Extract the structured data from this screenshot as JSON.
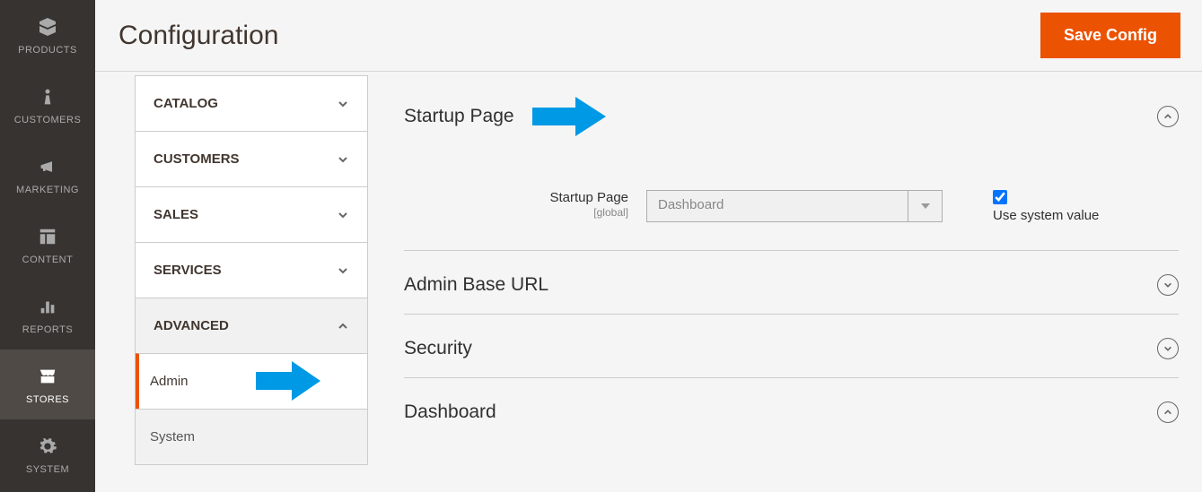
{
  "rail": {
    "items": [
      {
        "label": "PRODUCTS",
        "icon": "box"
      },
      {
        "label": "CUSTOMERS",
        "icon": "person"
      },
      {
        "label": "MARKETING",
        "icon": "megaphone"
      },
      {
        "label": "CONTENT",
        "icon": "layout"
      },
      {
        "label": "REPORTS",
        "icon": "bars"
      },
      {
        "label": "STORES",
        "icon": "store",
        "active": true
      },
      {
        "label": "SYSTEM",
        "icon": "gear"
      }
    ]
  },
  "header": {
    "title": "Configuration",
    "save_label": "Save Config"
  },
  "config_nav": {
    "groups": [
      {
        "label": "CATALOG",
        "expanded": false
      },
      {
        "label": "CUSTOMERS",
        "expanded": false
      },
      {
        "label": "SALES",
        "expanded": false
      },
      {
        "label": "SERVICES",
        "expanded": false
      },
      {
        "label": "ADVANCED",
        "expanded": true
      }
    ],
    "subs": [
      {
        "label": "Admin",
        "active": true
      },
      {
        "label": "System",
        "active": false
      }
    ]
  },
  "sections": {
    "startup": {
      "title": "Startup Page",
      "field_label": "Startup Page",
      "field_scope": "[global]",
      "select_value": "Dashboard",
      "use_system_label": "Use system value",
      "use_system_checked": true,
      "expanded": true
    },
    "base_url": {
      "title": "Admin Base URL",
      "expanded": false
    },
    "security": {
      "title": "Security",
      "expanded": false
    },
    "dashboard": {
      "title": "Dashboard",
      "expanded": true
    }
  }
}
